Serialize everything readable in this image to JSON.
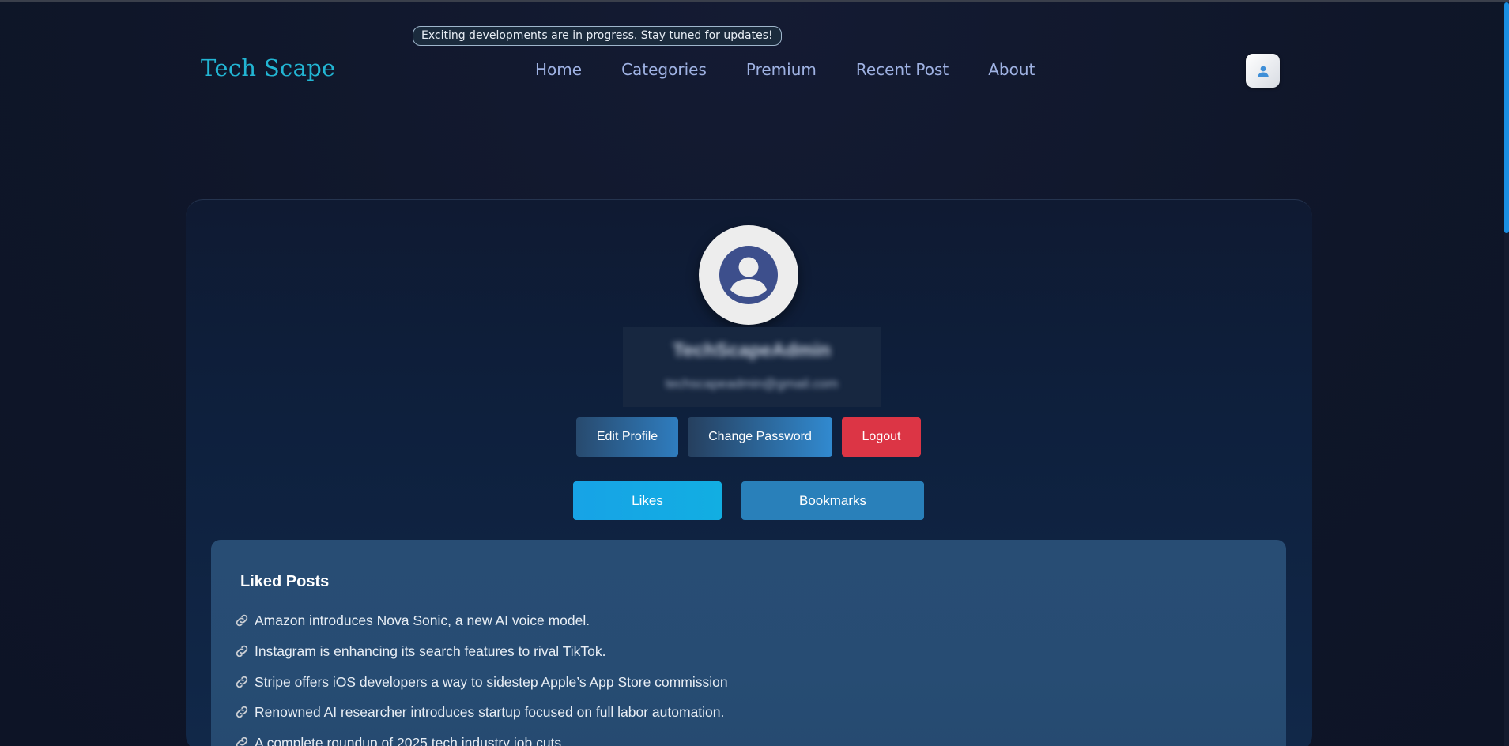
{
  "header": {
    "announcement": "Exciting developments are in progress. Stay tuned for updates!",
    "logo": "Tech Scape",
    "nav": [
      {
        "label": "Home"
      },
      {
        "label": "Categories"
      },
      {
        "label": "Premium"
      },
      {
        "label": "Recent Post"
      },
      {
        "label": "About"
      }
    ],
    "user_icon": "user-icon"
  },
  "profile": {
    "avatar_icon": "user-circle-icon",
    "username": "TechScapeAdmin",
    "email": "techscapeadmin@gmail.com",
    "buttons": {
      "edit": "Edit Profile",
      "change_password": "Change Password",
      "logout": "Logout"
    },
    "tabs": {
      "likes": "Likes",
      "bookmarks": "Bookmarks"
    }
  },
  "liked_posts": {
    "title": "Liked Posts",
    "link_icon": "link-icon",
    "items": [
      "Amazon introduces Nova Sonic, a new AI voice model.",
      "Instagram is enhancing its search features to rival TikTok.",
      "Stripe offers iOS developers a way to sidestep Apple’s App Store commission",
      "Renowned AI researcher introduces startup focused on full labor automation.",
      "A complete roundup of 2025 tech industry job cuts"
    ]
  },
  "colors": {
    "background": "#0f1629",
    "logo": "#22b5d3",
    "nav": "#9fb2e3",
    "logout": "#dc3545",
    "likes_tab": "#17a3e6",
    "bookmarks_tab": "#2980ba",
    "panel": "#284d74"
  }
}
